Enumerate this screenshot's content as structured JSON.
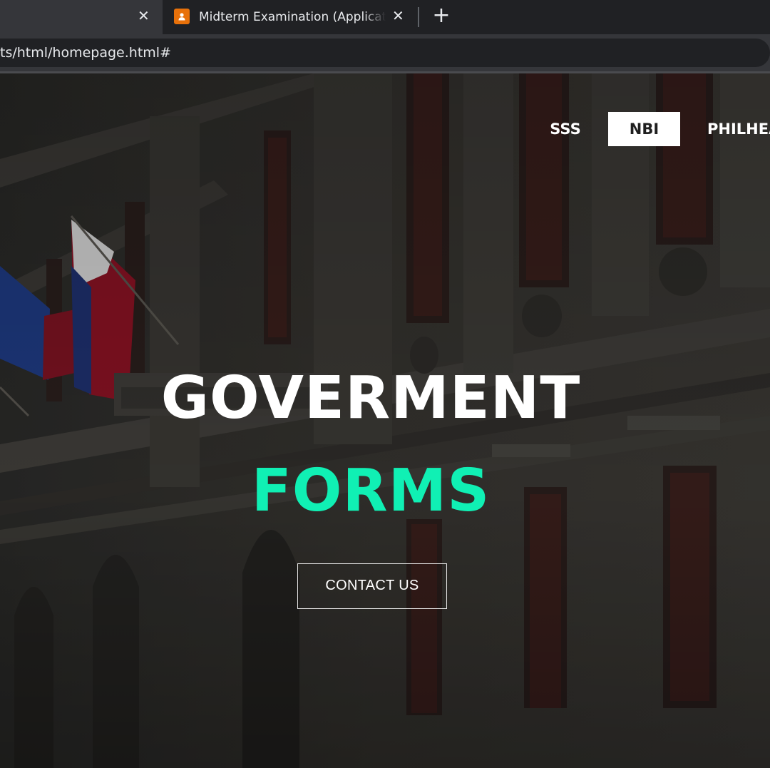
{
  "browser": {
    "tabs": [
      {
        "title": "",
        "active": false
      },
      {
        "title": "Midterm Examination (Application",
        "active": true
      }
    ],
    "address_bar": {
      "url": "ts/html/homepage.html#"
    },
    "icons": {
      "close": "close-icon",
      "new_tab": "plus-icon",
      "favicon": "google-classroom-icon"
    }
  },
  "page": {
    "nav": {
      "items": [
        {
          "label": "SSS",
          "active": false
        },
        {
          "label": "NBI",
          "active": true
        },
        {
          "label": "PHILHEA",
          "active": false
        }
      ]
    },
    "hero": {
      "title_line1": "GOVERMENT",
      "title_line2": "FORMS",
      "cta_label": "CONTACT US"
    },
    "colors": {
      "accent": "#10f0b4",
      "nav_active_bg": "#ffffff",
      "overlay": "#2c2b29"
    }
  }
}
